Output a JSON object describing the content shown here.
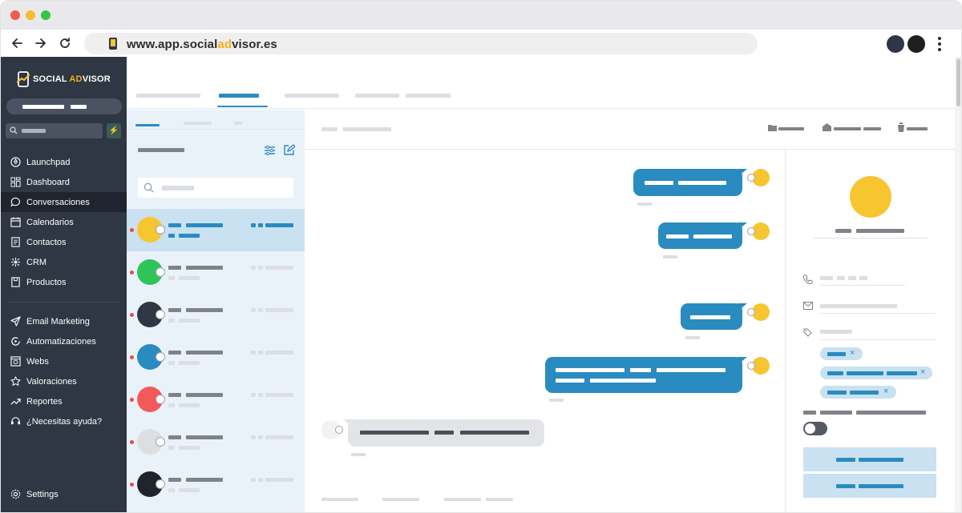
{
  "browser": {
    "url_prefix": "www.app.social",
    "url_highlight": "ad",
    "url_suffix": "visor.es"
  },
  "brand": {
    "name_prefix": "SOCIAL ",
    "name_highlight": "AD",
    "name_suffix": "VISOR"
  },
  "sidebar": {
    "menu": [
      {
        "label": "Launchpad",
        "icon": "rocket-icon"
      },
      {
        "label": "Dashboard",
        "icon": "grid-icon"
      },
      {
        "label": "Conversaciones",
        "icon": "chat-bubble-icon",
        "active": true
      },
      {
        "label": "Calendarios",
        "icon": "calendar-icon"
      },
      {
        "label": "Contactos",
        "icon": "address-book-icon"
      },
      {
        "label": "CRM",
        "icon": "network-icon"
      },
      {
        "label": "Productos",
        "icon": "box-icon"
      }
    ],
    "menu2": [
      {
        "label": "Email Marketing",
        "icon": "send-icon"
      },
      {
        "label": "Automatizaciones",
        "icon": "automation-icon"
      },
      {
        "label": "Webs",
        "icon": "web-icon"
      },
      {
        "label": "Valoraciones",
        "icon": "star-icon"
      },
      {
        "label": "Reportes",
        "icon": "trend-icon"
      },
      {
        "label": "¿Necesitas ayuda?",
        "icon": "headset-icon"
      }
    ],
    "settings_label": "Settings"
  },
  "colors": {
    "sidebar_bg": "#2f3644",
    "accent_blue": "#2a8bc1",
    "accent_yellow": "#f7c52f",
    "selected_row": "#c9e1f0",
    "unread_dot": "#e84b4b"
  },
  "conversations": [
    {
      "avatar_color": "#f7c52f",
      "channel": "instagram-icon",
      "selected": true
    },
    {
      "avatar_color": "#2fc45a",
      "channel": "email-icon"
    },
    {
      "avatar_color": "#2f3644",
      "channel": "email-icon"
    },
    {
      "avatar_color": "#2a8bc1",
      "channel": "telegram-icon"
    },
    {
      "avatar_color": "#f25a5a",
      "channel": "instagram-icon"
    },
    {
      "avatar_color": "#dcdee2",
      "channel": "telegram-icon"
    },
    {
      "avatar_color": "#1f242e",
      "channel": "email-icon"
    }
  ]
}
